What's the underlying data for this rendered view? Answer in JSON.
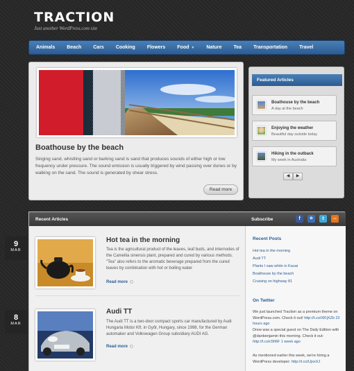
{
  "site": {
    "title": "TRACTION",
    "tagline": "Just another WordPress.com site"
  },
  "nav": [
    "Animals",
    "Beach",
    "Cars",
    "Cooking",
    "Flowers",
    "Food",
    "Nature",
    "Tea",
    "Transportation",
    "Travel"
  ],
  "slider": {
    "title": "Boathouse by the beach",
    "excerpt": "Singing sand, whistling sand or barking sand is sand that produces sounds of either high or low frequency under pressure. The sound emission is usually triggered by wind passing over dunes or by walking on the sand. The sound is generated by shear stress.",
    "read_more": "Read more"
  },
  "featured": {
    "heading": "Featured Articles",
    "items": [
      {
        "title": "Boathouse by the beach",
        "subtitle": "A day at the beach"
      },
      {
        "title": "Enjoying the weather",
        "subtitle": "Beautiful day outside today"
      },
      {
        "title": "Hiking in the outback",
        "subtitle": "My week in Australia"
      }
    ],
    "prev": "◀",
    "next": "▶"
  },
  "recent": {
    "heading": "Recent Articles",
    "posts": [
      {
        "day": "9",
        "month": "MAR",
        "title": "Hot tea in the morning",
        "excerpt": "Tea is the agricultural product of the leaves, leaf buds, and internodes of the Camellia sinensis plant, prepared and cured by various methods. \"Tea\" also refers to the aromatic beverage prepared from the cured leaves by combination with hot or boiling water",
        "read_more": "Read more"
      },
      {
        "day": "8",
        "month": "MAR",
        "title": "Audi TT",
        "excerpt": "The Audi TT is a two-door compact sports car manufactured by Audi Hungaria Motor Kft. in Győr, Hungary, since 1998, for the German automaker and Volkswagen Group subsidiary AUDI AG.",
        "read_more": "Read more"
      }
    ]
  },
  "sidebar": {
    "subscribe": "Subscribe",
    "social": [
      "f",
      "✿",
      "t",
      "rss"
    ],
    "recent_posts_heading": "Recent Posts",
    "recent_posts": [
      "Hot tea in the morning",
      "Audi TT",
      "Plants I saw while in Kauai",
      "Boathouse by the beach",
      "Cruising on highway 81"
    ],
    "twitter_heading": "On Twitter",
    "tweets": [
      {
        "text": "We just launched Traction as a premium theme on WordPress.com. Check it out!",
        "link": "http://t.co/XlFjXZb",
        "time": "22 hours ago"
      },
      {
        "text": "Drew was a special guest on The Daily Edition with @danbenjamin this morning. Check it out:",
        "link": "http://t.co/c5fi6F",
        "time": "1 week ago"
      },
      {
        "text": "As mentioned earlier this week, we're hiring a WordPress developer:",
        "link": "http://t.co/UjxxXJ",
        "time": ""
      }
    ]
  }
}
